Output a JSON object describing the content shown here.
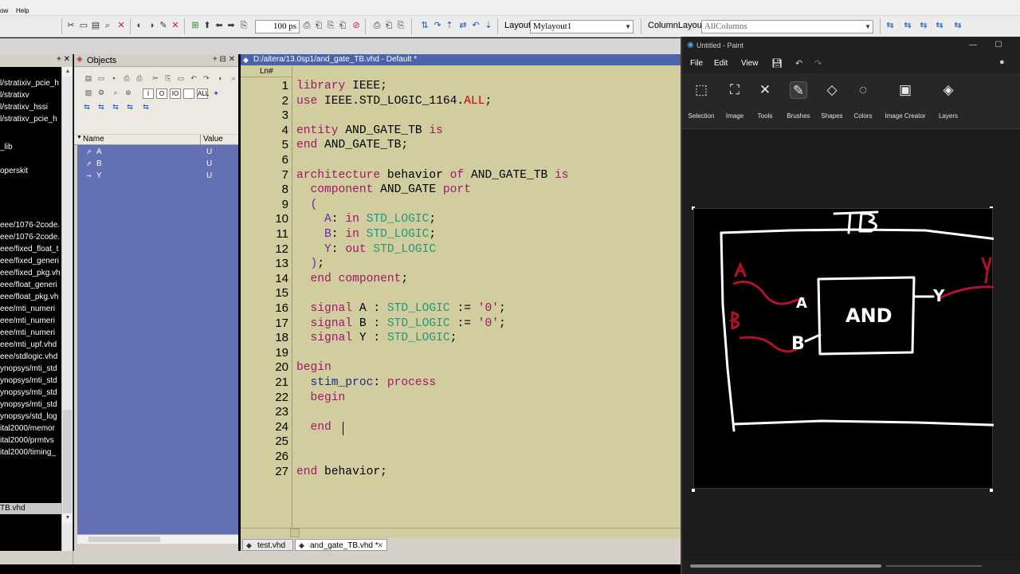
{
  "menubar": {
    "items": [
      "ow",
      "Help"
    ]
  },
  "toolbar": {
    "run_length": "100 ps",
    "layout_label": "Layout",
    "layout_value": "Mylayout1",
    "column_layout_label": "ColumnLayout",
    "column_layout_value": "AllColumns"
  },
  "library": {
    "items": [
      "l/stratixiv_pcie_h",
      "l/stratixv",
      "l/stratixv_hssi",
      "l/stratixv_pcie_h",
      "_lib",
      "operskit",
      "eee/1076-2code.",
      "eee/1076-2code.",
      "eee/fixed_float_t",
      "eee/fixed_generi",
      "eee/fixed_pkg.vh",
      "eee/float_generi",
      "eee/float_pkg.vh",
      "eee/mti_numeri",
      "eee/mti_numeri",
      "eee/mti_numeri",
      "eee/mti_upf.vhd",
      "eee/stdlogic.vhd",
      "ynopsys/mti_std",
      "ynopsys/mti_std",
      "ynopsys/mti_std",
      "ynopsys/mti_std",
      "ynopsys/std_log",
      "ital2000/memor",
      "ital2000/prmtvs",
      "ital2000/timing_",
      "TB.vhd"
    ]
  },
  "objects": {
    "title": "Objects",
    "columns": {
      "name": "Name",
      "value": "Value"
    },
    "rows": [
      {
        "name": "A",
        "value": "U"
      },
      {
        "name": "B",
        "value": "U"
      },
      {
        "name": "Y",
        "value": "U"
      }
    ],
    "filter_buttons": [
      "I",
      "O",
      "IO",
      "",
      "ALL"
    ]
  },
  "editor": {
    "title": "D:/altera/13.0sp1/and_gate_TB.vhd - Default *",
    "column_header": "Ln#",
    "line_numbers": [
      "1",
      "2",
      "3",
      "4",
      "5",
      "6",
      "7",
      "8",
      "9",
      "10",
      "11",
      "12",
      "13",
      "14",
      "15",
      "16",
      "17",
      "18",
      "19",
      "20",
      "21",
      "22",
      "23",
      "24",
      "25",
      "26",
      "27"
    ],
    "lines": [
      "library IEEE;",
      "use IEEE.STD_LOGIC_1164.ALL;",
      "",
      "entity AND_GATE_TB is",
      "end AND_GATE_TB;",
      "",
      "architecture behavior of AND_GATE_TB is",
      "  component AND_GATE port",
      "  (",
      "    A: in STD_LOGIC;",
      "    B: in STD_LOGIC;",
      "    Y: out STD_LOGIC",
      "  );",
      "  end component;",
      "",
      "  signal A : STD_LOGIC := '0';",
      "  signal B : STD_LOGIC := '0';",
      "  signal Y : STD_LOGIC;",
      "",
      "begin",
      "  stim_proc: process",
      "  begin",
      "",
      "  end ",
      "",
      "",
      "end behavior;"
    ],
    "tabs": [
      {
        "label": "test.vhd",
        "active": false
      },
      {
        "label": "and_gate_TB.vhd *",
        "active": true
      }
    ]
  },
  "paint": {
    "window_title": "Untitled - Paint",
    "menu": [
      "File",
      "Edit",
      "View"
    ],
    "ribbon": [
      {
        "label": "Selection",
        "icon": "selection-icon"
      },
      {
        "label": "Image",
        "icon": "image-icon"
      },
      {
        "label": "Tools",
        "icon": "tools-icon"
      },
      {
        "label": "Brushes",
        "icon": "brushes-icon"
      },
      {
        "label": "Shapes",
        "icon": "shapes-icon"
      },
      {
        "label": "Colors",
        "icon": "colors-icon"
      },
      {
        "label": "Image Creator",
        "icon": "image-creator-icon"
      },
      {
        "label": "Layers",
        "icon": "layers-icon"
      }
    ],
    "drawing": {
      "top_label": "TB",
      "gate_label": "AND",
      "input_a": "A",
      "input_b": "B",
      "output_y": "Y"
    }
  },
  "colors": {
    "editor_bg": "#d1cd9e",
    "keyword": "#a0166a",
    "type": "#1f9a7a",
    "objects_bg": "#6470b4",
    "ink_white": "#ffffff",
    "ink_red": "#b0122c"
  }
}
